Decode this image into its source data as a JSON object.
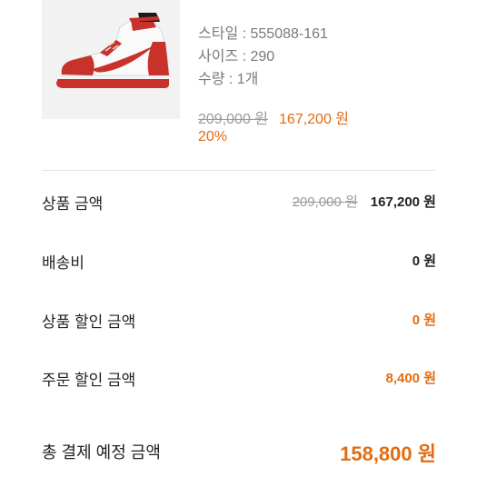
{
  "product": {
    "image_icon": "sneaker-icon",
    "style": "스타일 : 555088-161",
    "size": "사이즈 : 290",
    "quantity": "수량 : 1개",
    "original_price": "209,000 원",
    "sale_price": "167,200 원",
    "discount_rate": "20%"
  },
  "summary": {
    "product_amount": {
      "label": "상품 금액",
      "original": "209,000 원",
      "value": "167,200 원"
    },
    "shipping": {
      "label": "배송비",
      "value": "0 원"
    },
    "product_discount": {
      "label": "상품 할인 금액",
      "value": "0 원"
    },
    "order_discount": {
      "label": "주문 할인 금액",
      "value": "8,400 원"
    },
    "total": {
      "label": "총 결제 예정 금액",
      "value": "158,800 원"
    }
  },
  "colors": {
    "accent": "#e36c12",
    "muted": "#9a9a9a",
    "text": "#222222"
  }
}
